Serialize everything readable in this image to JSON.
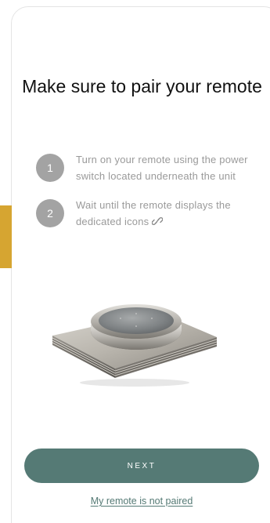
{
  "page": {
    "title": "Make sure to pair your remote"
  },
  "steps": [
    {
      "number": "1",
      "text": "Turn on your remote using the power switch located underneath the unit"
    },
    {
      "number": "2",
      "text": "Wait until the remote displays the dedicated icons",
      "icon": "link-icon"
    }
  ],
  "actions": {
    "next_label": "NEXT",
    "not_paired_label": "My remote is not paired"
  },
  "colors": {
    "accent": "#557a75",
    "left_marker": "#d6a531",
    "step_circle": "#a3a3a3",
    "step_text": "#9a9a9a"
  }
}
